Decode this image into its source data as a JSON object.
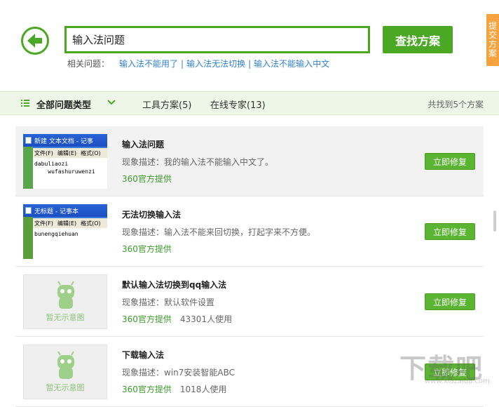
{
  "search": {
    "value": "输入法问题",
    "button_label": "查找方案"
  },
  "related": {
    "label": "相关问题：",
    "links": [
      "输入法不能用了",
      "输入法无法切换",
      "输入法不能输入中文"
    ],
    "separator": "|"
  },
  "feedback_tab": [
    "提",
    "交",
    "方",
    "案"
  ],
  "filter": {
    "all_types": "全部问题类型",
    "tools_tab": "工具方案(5)",
    "experts_tab": "在线专家(13)",
    "found_text": "共找到5个方案"
  },
  "results": [
    {
      "title": "输入法问题",
      "desc": "现象描述：我的输入法不能输入中文了。",
      "source": "360官方提供",
      "uses": "",
      "fix_label": "立即修复",
      "thumb": {
        "type": "notepad",
        "title": "新建 文本文档 - 记事",
        "menus": [
          "文件(F)",
          "编辑(E)",
          "格式(O)"
        ],
        "lines": [
          "dabuliaozi",
          "    wufashuruwenzi"
        ]
      }
    },
    {
      "title": "无法切换输入法",
      "desc": "现象描述：输入法不能来回切换，打起字来不方便。",
      "source": "360官方提供",
      "uses": "",
      "fix_label": "立即修复",
      "thumb": {
        "type": "notepad",
        "title": "无标题 - 记事本",
        "menus": [
          "文件(F)",
          "编辑(E)",
          "格式(O)"
        ],
        "lines": [
          "bunengqiehuan"
        ]
      }
    },
    {
      "title": "默认输入法切换到qq输入法",
      "desc": "现象描述：默认软件设置",
      "source": "360官方提供",
      "uses": "43301人使用",
      "fix_label": "立即修复",
      "thumb": {
        "type": "placeholder",
        "text": "暂无示意图"
      }
    },
    {
      "title": "下载输入法",
      "desc": "现象描述：win7安装智能ABC",
      "source": "360官方提供",
      "uses": "1018人使用",
      "fix_label": "立即修复",
      "thumb": {
        "type": "placeholder",
        "text": "暂无示意图"
      }
    }
  ],
  "watermark": {
    "big": "下载吧",
    "small": "www.xiazaiba.com"
  },
  "colors": {
    "accent": "#4aa825",
    "link": "#2f7fd1",
    "feedback": "#f5a33f"
  }
}
